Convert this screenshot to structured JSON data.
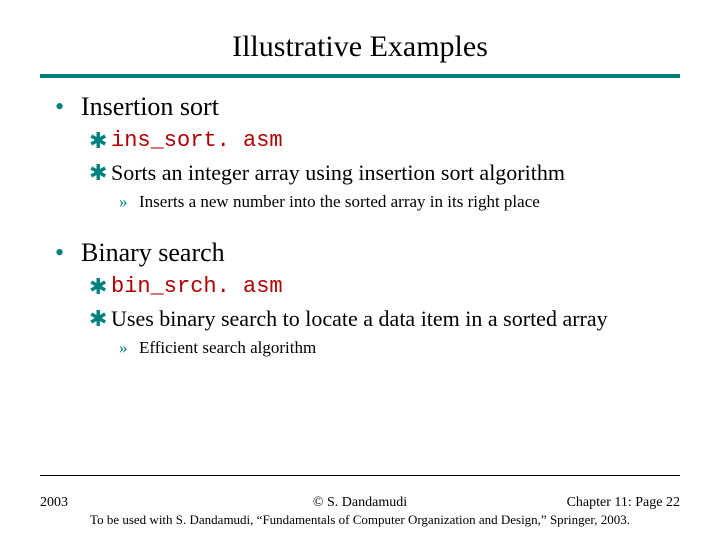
{
  "title": "Illustrative Examples",
  "sections": [
    {
      "heading": "Insertion sort",
      "items": [
        {
          "text": "ins_sort. asm",
          "code": true
        },
        {
          "text": "Sorts an integer array using insertion sort algorithm",
          "code": false,
          "sub": [
            "Inserts a new number into the sorted array in its right place"
          ]
        }
      ]
    },
    {
      "heading": "Binary search",
      "items": [
        {
          "text": "bin_srch. asm",
          "code": true
        },
        {
          "text": "Uses binary search to locate a data item in a sorted array",
          "code": false,
          "sub": [
            "Efficient search algorithm"
          ]
        }
      ]
    }
  ],
  "footer": {
    "year": "2003",
    "copyright": "© S. Dandamudi",
    "page": "Chapter 11: Page 22",
    "subtitle": "To be used with S. Dandamudi, “Fundamentals of Computer Organization and Design,” Springer, 2003."
  },
  "bullets": {
    "l1": "•",
    "l2": "✱",
    "l3": "»"
  }
}
